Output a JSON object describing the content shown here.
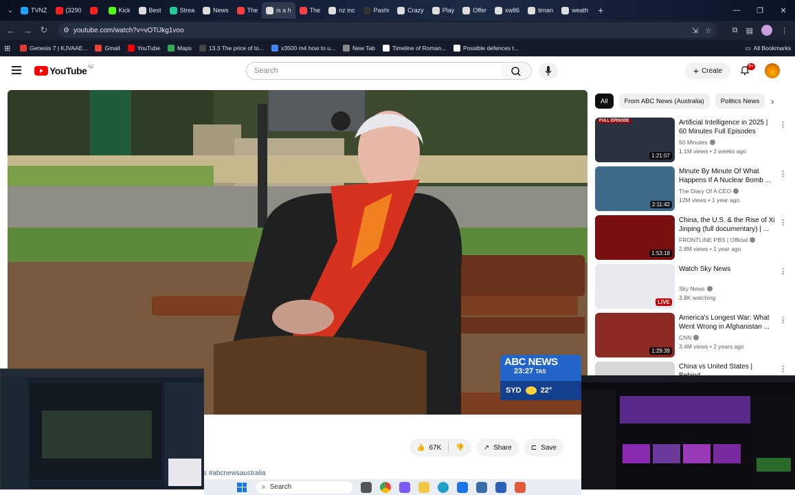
{
  "browser": {
    "tabs": [
      {
        "label": "TVNZ",
        "color": "#1aa3ff"
      },
      {
        "label": "(3290",
        "color": "#ff2020"
      },
      {
        "label": "",
        "color": "#ff2020"
      },
      {
        "label": "Kick",
        "color": "#53fc18"
      },
      {
        "label": "Best",
        "color": "#dddddd"
      },
      {
        "label": "Strea",
        "color": "#20c997"
      },
      {
        "label": "News",
        "color": "#dddddd"
      },
      {
        "label": "The",
        "color": "#ff4040"
      },
      {
        "label": "is a h",
        "color": "#dddddd"
      },
      {
        "label": "The",
        "color": "#ff4040"
      },
      {
        "label": "nz inc",
        "color": "#dddddd"
      },
      {
        "label": "Pashi",
        "color": "#333333"
      },
      {
        "label": "Crazy",
        "color": "#dddddd"
      },
      {
        "label": "Play",
        "color": "#dddddd"
      },
      {
        "label": "Offer",
        "color": "#dddddd"
      },
      {
        "label": "xw86",
        "color": "#dddddd"
      },
      {
        "label": "timan",
        "color": "#dddddd"
      },
      {
        "label": "weath",
        "color": "#dddddd"
      }
    ],
    "url": "youtube.com/watch?v=vOTiJkg1voo",
    "bookmarks": [
      {
        "label": "Genesis 7 | KJVAAE...",
        "color": "#e53935"
      },
      {
        "label": "Gmail",
        "color": "#ea4335"
      },
      {
        "label": "YouTube",
        "color": "#ff0000"
      },
      {
        "label": "Maps",
        "color": "#34a853"
      },
      {
        "label": "13.3 The price of to...",
        "color": "#444444"
      },
      {
        "label": "x3500 m4 how to u...",
        "color": "#4285f4"
      },
      {
        "label": "New Tab",
        "color": "#888888"
      },
      {
        "label": "Timeline of Roman...",
        "color": "#ffffff"
      },
      {
        "label": "Possible defences t...",
        "color": "#ffffff"
      }
    ],
    "bookmarks_icon_labels": [
      "W",
      "CL"
    ],
    "all_bookmarks": "All Bookmarks"
  },
  "youtube": {
    "logo": "YouTube",
    "country": "NZ",
    "search_placeholder": "Search",
    "create_label": "Create",
    "notification_count": "9+",
    "chips": [
      "All",
      "From ABC News (Australia)",
      "Politics News"
    ],
    "overlay": {
      "brand": "ABC NEWS",
      "time": "23:27",
      "tz": "TAS",
      "city": "SYD",
      "temp": "22°"
    },
    "actions": {
      "likes": "67K",
      "share": "Share",
      "save": "Save"
    },
    "hashtag": "s #abcnewsaustralia",
    "related": [
      {
        "title": "Artificial Intelligence in 2025 | 60 Minutes Full Episodes",
        "channel": "60 Minutes",
        "meta": "1.1M views • 2 weeks ago",
        "duration": "1:21:07",
        "badge": "FULL EPISODE",
        "thumb_color": "#2a3140"
      },
      {
        "title": "Minute By Minute Of What Happens If A Nuclear Bomb ...",
        "channel": "The Diary Of A CEO",
        "meta": "12M views • 1 year ago",
        "duration": "2:11:42",
        "badge": "",
        "thumb_color": "#3f6b8a"
      },
      {
        "title": "China, the U.S. & the Rise of Xi Jinping (full documentary) | ...",
        "channel": "FRONTLINE PBS | Official",
        "meta": "2.8M views • 1 year ago",
        "duration": "1:53:18",
        "badge": "",
        "thumb_color": "#7a0f12"
      },
      {
        "title": "Watch Sky News",
        "channel": "Sky News",
        "meta": "3.8K watching",
        "duration": "LIVE",
        "badge": "",
        "thumb_color": "#e8eaef"
      },
      {
        "title": "America's Longest War: What Went Wrong in Afghanistan ...",
        "channel": "CNN",
        "meta": "3.4M views • 2 years ago",
        "duration": "1:29:39",
        "badge": "",
        "thumb_color": "#8a2a22"
      },
      {
        "title": "China vs United States | Behind",
        "channel": "",
        "meta": "",
        "duration": "",
        "badge": "",
        "thumb_color": "#d8d8d8"
      }
    ]
  },
  "taskbar": {
    "search": "Search"
  }
}
